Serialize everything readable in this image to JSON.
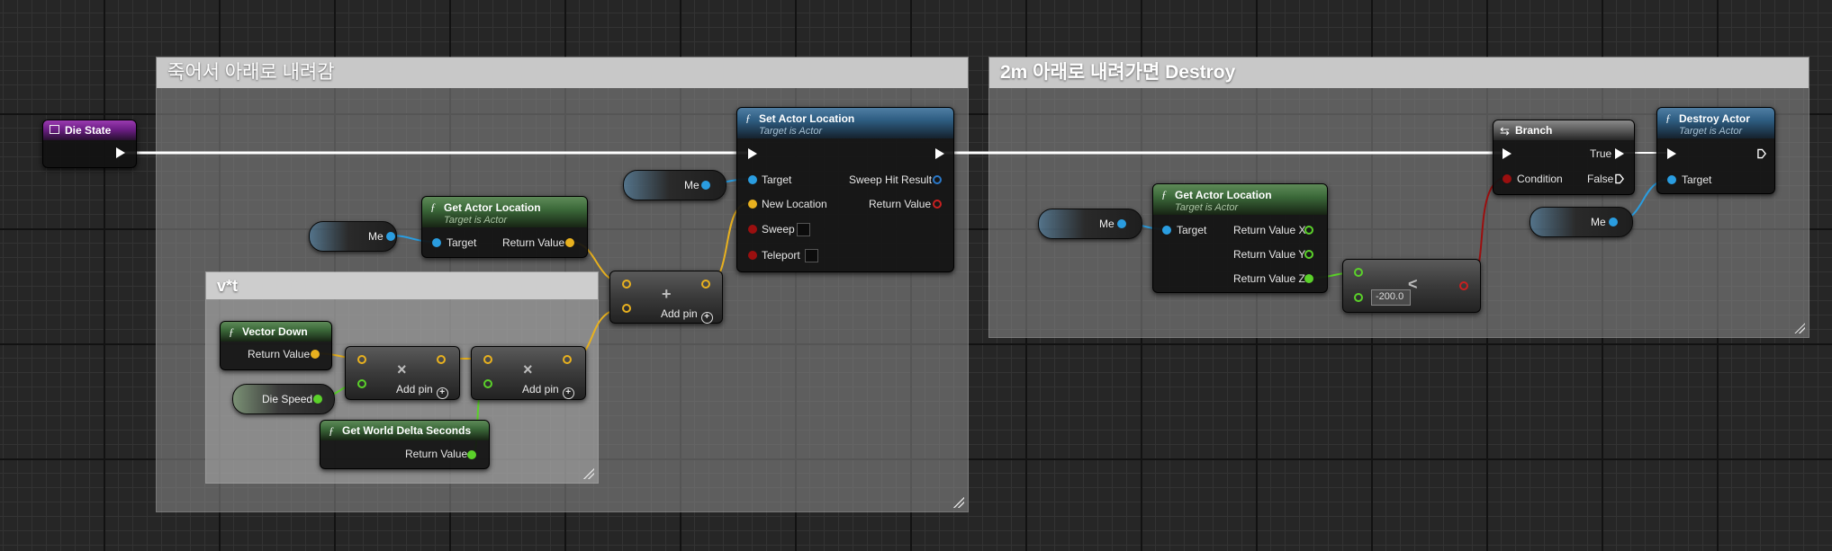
{
  "comments": {
    "fall_down": "죽어서 아래로 내려감",
    "destroy": "2m 아래로 내려가면 Destroy",
    "vt": "v*t"
  },
  "nodes": {
    "die_state": {
      "title": "Die State"
    },
    "set_actor_location": {
      "title": "Set Actor Location",
      "subtitle": "Target is Actor",
      "pins": {
        "target": "Target",
        "new_location": "New Location",
        "sweep": "Sweep",
        "teleport": "Teleport",
        "sweep_hit_result": "Sweep Hit Result",
        "return_value": "Return Value"
      }
    },
    "get_actor_location_1": {
      "title": "Get Actor Location",
      "subtitle": "Target is Actor",
      "pins": {
        "target": "Target",
        "return_value": "Return Value"
      }
    },
    "get_actor_location_2": {
      "title": "Get Actor Location",
      "subtitle": "Target is Actor",
      "pins": {
        "target": "Target",
        "return_x": "Return Value X",
        "return_y": "Return Value Y",
        "return_z": "Return Value Z"
      }
    },
    "vector_down": {
      "title": "Vector Down",
      "pins": {
        "return_value": "Return Value"
      }
    },
    "get_world_delta_seconds": {
      "title": "Get World Delta Seconds",
      "pins": {
        "return_value": "Return Value"
      }
    },
    "branch": {
      "title": "Branch",
      "pins": {
        "condition": "Condition",
        "true": "True",
        "false": "False"
      }
    },
    "destroy_actor": {
      "title": "Destroy Actor",
      "subtitle": "Target is Actor",
      "pins": {
        "target": "Target"
      }
    },
    "add_vector": {
      "symbol": "+",
      "add_pin": "Add pin"
    },
    "multiply_1": {
      "symbol": "×",
      "add_pin": "Add pin"
    },
    "multiply_2": {
      "symbol": "×",
      "add_pin": "Add pin"
    },
    "less_than": {
      "symbol": "<",
      "value": "-200.0"
    }
  },
  "variables": {
    "me": "Me",
    "die_speed": "Die Speed"
  },
  "colors": {
    "exec": "#ffffff",
    "object": "#2a9de0",
    "vector": "#e8b11f",
    "float": "#5bd12a",
    "bool": "#9b0f0f"
  }
}
